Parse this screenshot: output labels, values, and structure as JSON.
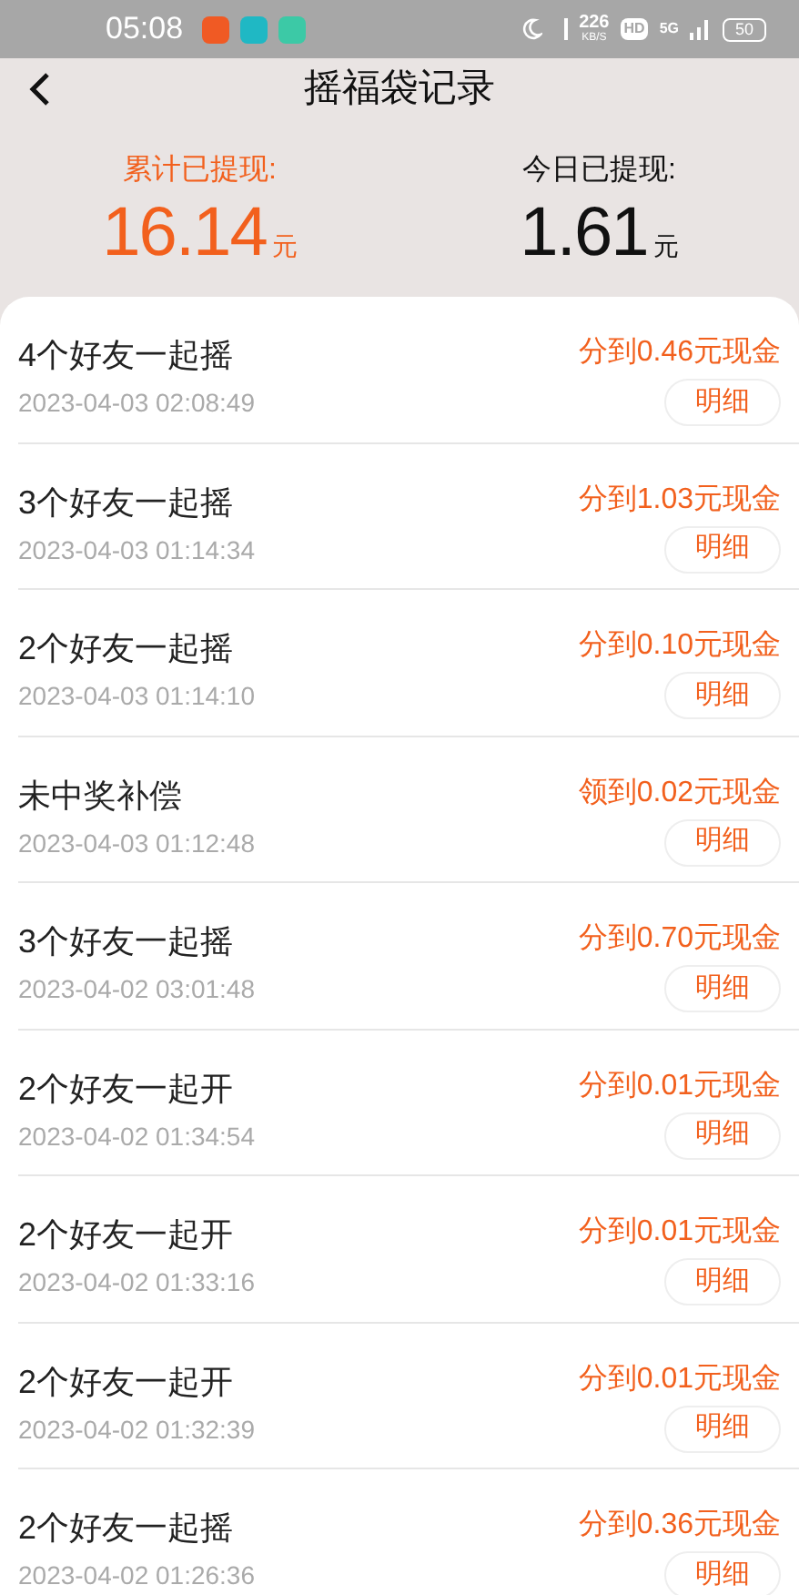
{
  "status_bar": {
    "time": "05:08",
    "speed": "226",
    "speed_unit": "KB/S",
    "hd": "HD",
    "network": "5G",
    "battery": "50"
  },
  "header": {
    "title": "摇福袋记录"
  },
  "summary": [
    {
      "label": "累计已提现:",
      "amount": "16.14",
      "unit": "元",
      "highlight": true
    },
    {
      "label": "今日已提现:",
      "amount": "1.61",
      "unit": "元",
      "highlight": false
    }
  ],
  "records": [
    {
      "title": "4个好友一起摇",
      "time": "2023-04-03 02:08:49",
      "reward": "分到0.46元现金",
      "button": "明细"
    },
    {
      "title": "3个好友一起摇",
      "time": "2023-04-03 01:14:34",
      "reward": "分到1.03元现金",
      "button": "明细"
    },
    {
      "title": "2个好友一起摇",
      "time": "2023-04-03 01:14:10",
      "reward": "分到0.10元现金",
      "button": "明细"
    },
    {
      "title": "未中奖补偿",
      "time": "2023-04-03 01:12:48",
      "reward": "领到0.02元现金",
      "button": "明细"
    },
    {
      "title": "3个好友一起摇",
      "time": "2023-04-02 03:01:48",
      "reward": "分到0.70元现金",
      "button": "明细"
    },
    {
      "title": "2个好友一起开",
      "time": "2023-04-02 01:34:54",
      "reward": "分到0.01元现金",
      "button": "明细"
    },
    {
      "title": "2个好友一起开",
      "time": "2023-04-02 01:33:16",
      "reward": "分到0.01元现金",
      "button": "明细"
    },
    {
      "title": "2个好友一起开",
      "time": "2023-04-02 01:32:39",
      "reward": "分到0.01元现金",
      "button": "明细"
    },
    {
      "title": "2个好友一起摇",
      "time": "2023-04-02 01:26:36",
      "reward": "分到0.36元现金",
      "button": "明细"
    }
  ]
}
